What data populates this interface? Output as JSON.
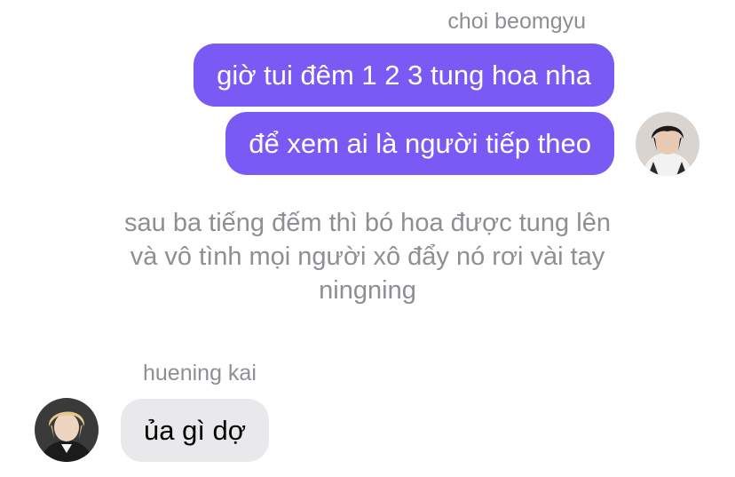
{
  "conversation": {
    "right_sender": "choi beomgyu",
    "left_sender": "huening kai",
    "messages_out": [
      "giờ tui đêm 1 2 3 tung hoa nha",
      "để xem ai là người tiếp theo"
    ],
    "narration_lines": [
      "sau ba tiếng đếm thì bó hoa được tung lên",
      "và vô tình mọi người xô đẩy nó rơi vài tay",
      "ningning"
    ],
    "messages_in": [
      "ủa gì dợ"
    ]
  },
  "colors": {
    "outgoing_bubble": "#7a5af5",
    "incoming_bubble": "#e9e9eb",
    "meta_text": "#8e8e93"
  },
  "icons": {
    "right_avatar": "person-avatar-icon",
    "left_avatar": "person-avatar-icon"
  }
}
